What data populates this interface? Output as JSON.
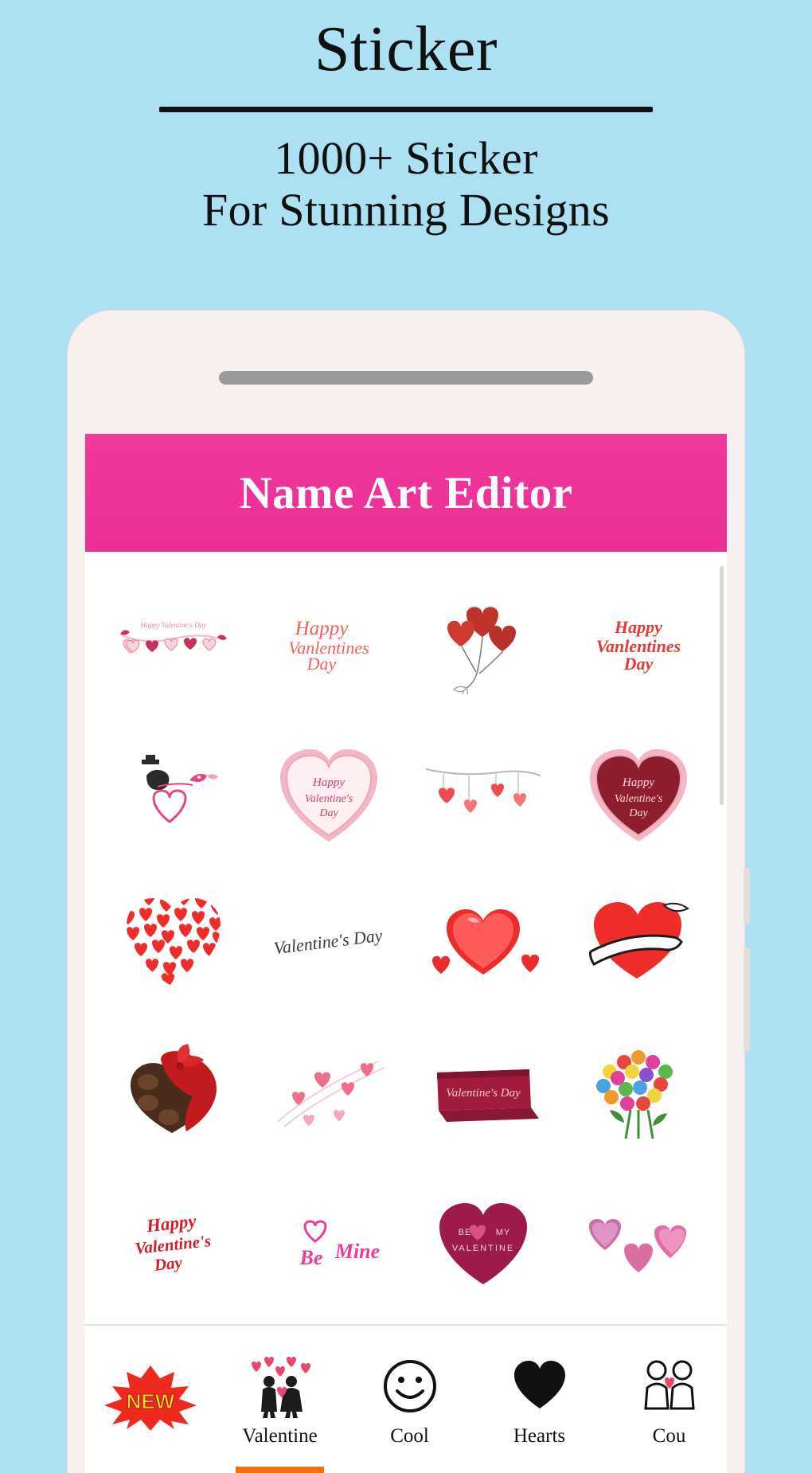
{
  "promo": {
    "title": "Sticker",
    "subtitle_line1": "1000+ Sticker",
    "subtitle_line2": "For Stunning Designs"
  },
  "app": {
    "title": "Name Art Editor",
    "accent_color": "#ee3399",
    "background_color": "#ace0f2",
    "screen_background": "#ffffff",
    "active_tab_color": "#f4700f"
  },
  "stickers": {
    "rows": [
      [
        {
          "name": "sticker-happy-valentines-day-heart-banner",
          "caption": "Happy Valentine's Day"
        },
        {
          "name": "sticker-happy-valentines-day-script-red",
          "caption": "Happy Valentines Day"
        },
        {
          "name": "sticker-heart-balloons",
          "caption": ""
        },
        {
          "name": "sticker-happy-valentines-day-bold-red",
          "caption": "Happy Vanlentines Day"
        }
      ],
      [
        {
          "name": "sticker-love-birds-heart",
          "caption": ""
        },
        {
          "name": "sticker-pink-lace-heart-card",
          "caption": "Happy Valentine's Day"
        },
        {
          "name": "sticker-hanging-hearts-branch",
          "caption": ""
        },
        {
          "name": "sticker-dark-red-lace-heart-card",
          "caption": "Happy Valentine's Day"
        }
      ],
      [
        {
          "name": "sticker-heart-made-of-hearts",
          "caption": ""
        },
        {
          "name": "sticker-valentines-day-handwritten",
          "caption": "Valentine's Day"
        },
        {
          "name": "sticker-glossy-red-hearts",
          "caption": ""
        },
        {
          "name": "sticker-heart-with-ribbon-banner",
          "caption": ""
        }
      ],
      [
        {
          "name": "sticker-heart-chocolate-box",
          "caption": ""
        },
        {
          "name": "sticker-pink-hearts-swirl",
          "caption": ""
        },
        {
          "name": "sticker-valentines-day-ribbon-banner",
          "caption": "Valentine's Day"
        },
        {
          "name": "sticker-flower-bouquet",
          "caption": ""
        }
      ],
      [
        {
          "name": "sticker-happy-valentines-day-red-script",
          "caption": "Happy Valentine's Day"
        },
        {
          "name": "sticker-be-mine-pink",
          "caption": "Be Mine"
        },
        {
          "name": "sticker-be-my-valentine-heart",
          "caption": "BE MY VALENTINE"
        },
        {
          "name": "sticker-glitter-hearts-trio",
          "caption": ""
        }
      ]
    ]
  },
  "tabs": [
    {
      "label": "",
      "icon": "new-burst-icon",
      "active": false
    },
    {
      "label": "Valentine",
      "icon": "valentine-couple-icon",
      "active": true
    },
    {
      "label": "Cool",
      "icon": "smiley-icon",
      "active": false
    },
    {
      "label": "Hearts",
      "icon": "heart-icon",
      "active": false
    },
    {
      "label": "Cou",
      "icon": "couple-icon",
      "active": false
    }
  ],
  "badges": {
    "new": "NEW"
  }
}
